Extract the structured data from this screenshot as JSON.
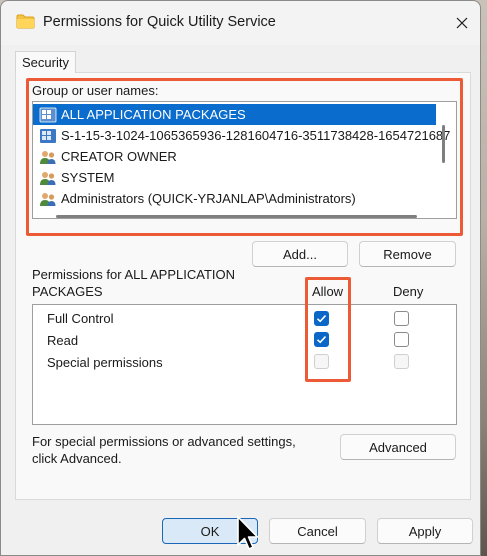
{
  "dialog": {
    "title": "Permissions for Quick Utility Service",
    "tab_label": "Security"
  },
  "users": {
    "label": "Group or user names:",
    "items": [
      {
        "name": "ALL APPLICATION PACKAGES",
        "icon": "app-package-icon",
        "selected": true
      },
      {
        "name": "S-1-15-3-1024-1065365936-1281604716-3511738428-1654721687",
        "icon": "app-package-icon",
        "selected": false
      },
      {
        "name": "CREATOR OWNER",
        "icon": "users-group-icon",
        "selected": false
      },
      {
        "name": "SYSTEM",
        "icon": "users-group-icon",
        "selected": false
      },
      {
        "name": "Administrators (QUICK-YRJANLAP\\Administrators)",
        "icon": "users-group-icon",
        "selected": false
      }
    ],
    "add_label": "Add...",
    "remove_label": "Remove"
  },
  "permissions": {
    "header_line1": "Permissions for ALL APPLICATION",
    "header_line2": "PACKAGES",
    "allow_label": "Allow",
    "deny_label": "Deny",
    "rows": [
      {
        "name": "Full Control",
        "allow": true,
        "deny": false,
        "enabled": true
      },
      {
        "name": "Read",
        "allow": true,
        "deny": false,
        "enabled": true
      },
      {
        "name": "Special permissions",
        "allow": false,
        "deny": false,
        "enabled": false
      }
    ]
  },
  "advanced": {
    "note_line1": "For special permissions or advanced settings,",
    "note_line2": "click Advanced.",
    "button_label": "Advanced"
  },
  "footer": {
    "ok_label": "OK",
    "cancel_label": "Cancel",
    "apply_label": "Apply"
  },
  "colors": {
    "accent": "#0a67c8",
    "selection": "#0a6ccd",
    "highlight_annotation": "#ec5b35"
  }
}
